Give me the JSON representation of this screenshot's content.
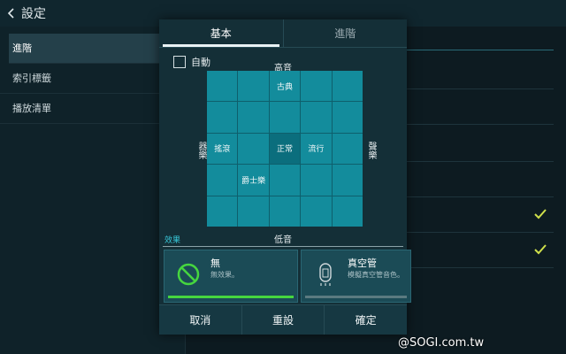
{
  "topbar": {
    "title": "設定"
  },
  "sidebar": {
    "items": [
      {
        "label": "進階"
      },
      {
        "label": "索引標籤"
      },
      {
        "label": "播放清單"
      }
    ]
  },
  "dialog": {
    "tabs": [
      {
        "label": "基本"
      },
      {
        "label": "進階"
      }
    ],
    "auto_label": "自動",
    "auto_checked": false,
    "axis": {
      "top": "高音",
      "bottom": "低音",
      "left": "器樂",
      "right": "聲樂"
    },
    "grid": [
      [
        "",
        "",
        "古典",
        "",
        ""
      ],
      [
        "",
        "",
        "",
        "",
        ""
      ],
      [
        "搖滾",
        "",
        "正常",
        "流行",
        ""
      ],
      [
        "",
        "爵士樂",
        "",
        "",
        ""
      ],
      [
        "",
        "",
        "",
        "",
        ""
      ]
    ],
    "selected_cell": "正常",
    "effects_title": "效果",
    "effects": [
      {
        "name": "無",
        "desc": "無效果。",
        "active": true,
        "icon": "no-effect-icon"
      },
      {
        "name": "真空管",
        "desc": "模擬真空管音色。",
        "active": false,
        "icon": "vacuum-tube-icon"
      }
    ],
    "buttons": {
      "cancel": "取消",
      "reset": "重設",
      "ok": "確定"
    }
  },
  "colors": {
    "accent": "#138c9c",
    "active_bar": "#46d63f",
    "section_title": "#38c7d8"
  },
  "watermark": "@SOGI.com.tw"
}
